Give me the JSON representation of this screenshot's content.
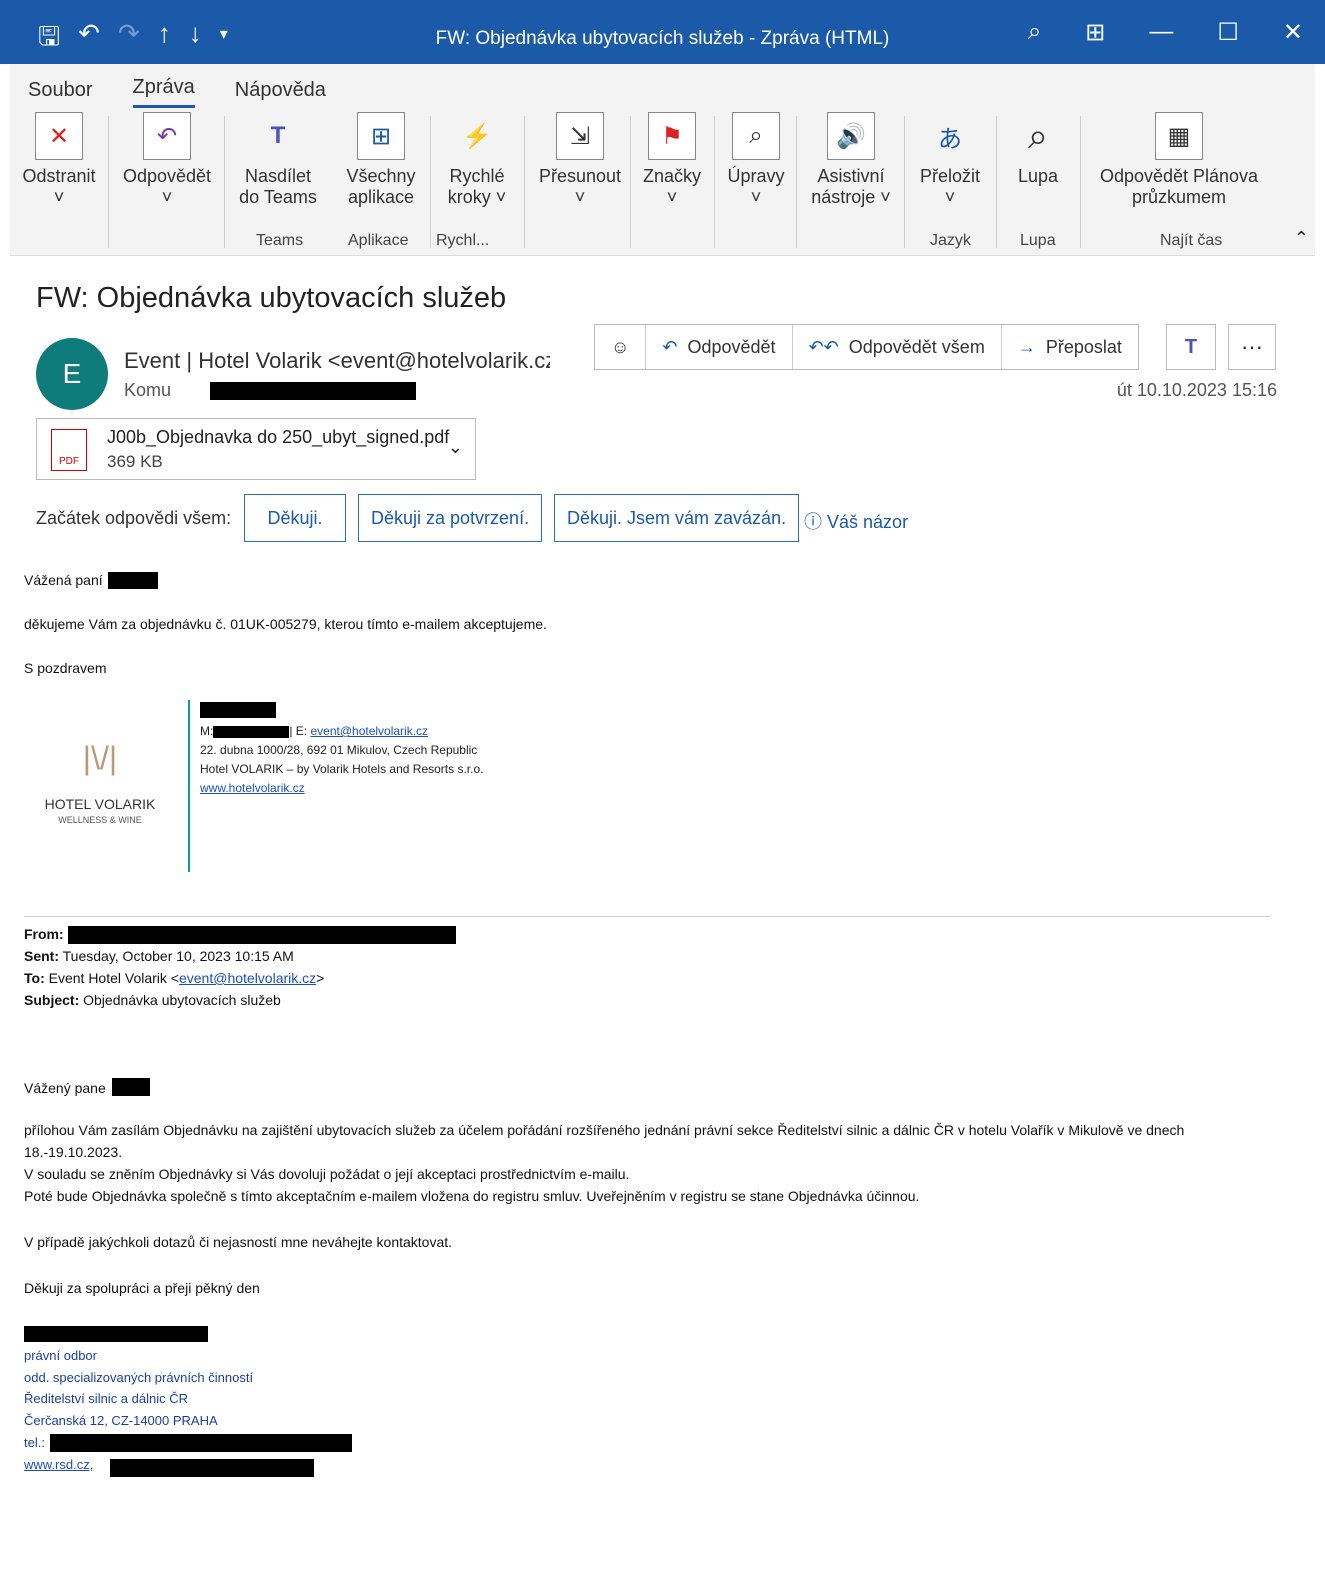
{
  "window": {
    "title": "FW: Objednávka ubytovacích služeb  -  Zpráva (HTML)"
  },
  "tabs": [
    "Soubor",
    "Zpráva",
    "Nápověda"
  ],
  "ribbon": {
    "odstranit": "Odstranit",
    "odpovedet": "Odpovědět",
    "nasdilet1": "Nasdílet",
    "nasdilet2": "do Teams",
    "vsechny1": "Všechny",
    "vsechny2": "aplikace",
    "rychle1": "Rychlé",
    "rychle2": "kroky ˅",
    "presunout": "Přesunout",
    "znacky": "Značky",
    "upravy": "Úpravy",
    "asist1": "Asistivní",
    "asist2": "nástroje ˅",
    "prelozit": "Přeložit",
    "lupa": "Lupa",
    "odpplan1": "Odpovědět Plánova",
    "odpplan2": "průzkumem",
    "g_teams": "Teams",
    "g_aplikace": "Aplikace",
    "g_rychl": "Rychl...",
    "g_jazyk": "Jazyk",
    "g_lupa": "Lupa",
    "g_najit": "Najít čas"
  },
  "message": {
    "subject": "FW: Objednávka ubytovacích služeb",
    "avatar": "E",
    "sender": "Event | Hotel Volarik <event@hotelvolarik.cz>",
    "komu": "Komu",
    "date": "út 10.10.2023 15:16"
  },
  "actions": {
    "reply": "Odpovědět",
    "reply_all": "Odpovědět všem",
    "forward": "Přeposlat",
    "teams": "T",
    "more": "···"
  },
  "attachment": {
    "name": "J00b_Objednavka do 250_ubyt_signed.pdf",
    "size": "369 KB",
    "type": "PDF"
  },
  "quick": {
    "label": "Začátek odpovědi všem:",
    "b1": "Děkuji.",
    "b2": "Děkuji za potvrzení.",
    "b3": "Děkuji. Jsem vám zavázán.",
    "feedback": "Váš názor"
  },
  "body": {
    "greet": "Vážená paní",
    "l1": "děkujeme Vám za objednávku č. 01UK-005279, kterou tímto e-mailem akceptujeme.",
    "l2": "S pozdravem",
    "sig_m": "M:",
    "sig_e": "| E:",
    "sig_email": "event@hotelvolarik.cz",
    "sig_addr": "22. dubna 1000/28, 692 01 Mikulov, Czech Republic",
    "sig_co": "Hotel VOLARIK – by Volarik Hotels and Resorts s.r.o.",
    "sig_web": "www.hotelvolarik.cz",
    "logo_mark": "|\\/|",
    "logo1": "HOTEL VOLARIK",
    "logo2": "WELLNESS & WINE"
  },
  "fwd": {
    "from_l": "From:",
    "sent_l": "Sent:",
    "sent": "Tuesday, October 10, 2023 10:15 AM",
    "to_l": "To:",
    "to": "Event Hotel Volarik <",
    "to_email": "event@hotelvolarik.cz",
    "to_end": ">",
    "subj_l": "Subject:",
    "subj": "Objednávka ubytovacích služeb",
    "greet": "Vážený pane",
    "p1": "přílohou Vám zasílám Objednávku na zajištění ubytovacích služeb za účelem pořádání rozšířeného jednání právní sekce Ředitelství silnic a dálnic ČR v hotelu Volařík v Mikulově ve dnech",
    "p1b": "18.-19.10.2023.",
    "p2": "V souladu se zněním Objednávky si Vás dovoluji požádat o její akceptaci prostřednictvím e-mailu.",
    "p3": "Poté bude Objednávka společně s tímto akceptačním e-mailem vložena do registru smluv. Uveřejněním v registru se stane Objednávka účinnou.",
    "p4": "V případě jakýchkoli dotazů či nejasností mne neváhejte kontaktovat.",
    "p5": "Děkuji za spolupráci a přeji pěkný den",
    "s1": "právní odbor",
    "s2": "odd. specializovaných právních činností",
    "s3": "Ředitelství silnic a dálnic  ČR",
    "s4": "Čerčanská 12, CZ-14000 PRAHA",
    "s5": "tel.:",
    "s6": "www.rsd.cz,"
  }
}
